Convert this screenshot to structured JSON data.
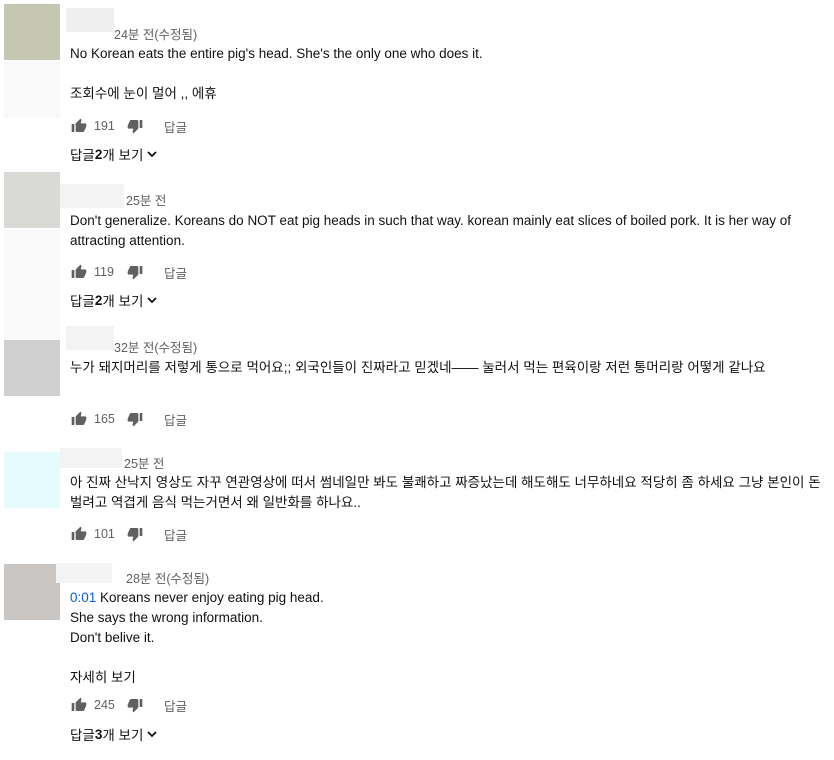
{
  "comments": [
    {
      "time": "24분 전(수정됨)",
      "text1": "No Korean eats the entire pig's head. She's the only one who does it.",
      "text2": "조회수에 눈이 멀어 ,, 에휴",
      "likes": "191",
      "reply_label": "답글",
      "view_replies": {
        "prefix": "답글 ",
        "count": "2",
        "suffix": "개 보기"
      }
    },
    {
      "time": "25분 전",
      "text1": "Don't generalize. Koreans do NOT eat pig heads in such that way. korean mainly eat slices of boiled pork. It is her way of attracting attention.",
      "likes": "119",
      "reply_label": "답글",
      "view_replies": {
        "prefix": "답글 ",
        "count": "2",
        "suffix": "개 보기"
      }
    },
    {
      "time": "32분 전(수정됨)",
      "text1": "누가 돼지머리를 저렇게 통으로 먹어요;; 외국인들이 진짜라고 믿겠네—— 눌러서 먹는 편육이랑 저런 통머리랑 어떻게 같나요",
      "likes": "165",
      "reply_label": "답글"
    },
    {
      "time": "25분 전",
      "text1": "아 진짜 산낙지 영상도 자꾸 연관영상에 떠서 썸네일만 봐도 불쾌하고 짜증났는데 해도해도 너무하네요 적당히 좀 하세요 그냥 본인이 돈벌려고 역겹게 음식 먹는거면서 왜 일반화를 하나요..",
      "likes": "101",
      "reply_label": "답글"
    },
    {
      "time": "28분 전(수정됨)",
      "timestamp": "0:01",
      "text1": " Koreans never enjoy eating pig head.",
      "text2": "She says the wrong information.",
      "text3": "Don't belive it.",
      "show_more": "자세히 보기",
      "likes": "245",
      "reply_label": "답글",
      "view_replies": {
        "prefix": "답글 ",
        "count": "3",
        "suffix": "개 보기"
      }
    }
  ],
  "colors": {
    "meta_text": "#606060",
    "timestamp_link": "#065fd4",
    "avatar_1": "#c5c7b3",
    "avatar_2": "#d9d9d6",
    "avatar_3": "#cfcfcf",
    "avatar_4": "#e6fbfd",
    "avatar_5": "#c8c5c2"
  },
  "icons": [
    "thumb-up-icon",
    "thumb-down-icon",
    "chevron-down-icon"
  ]
}
